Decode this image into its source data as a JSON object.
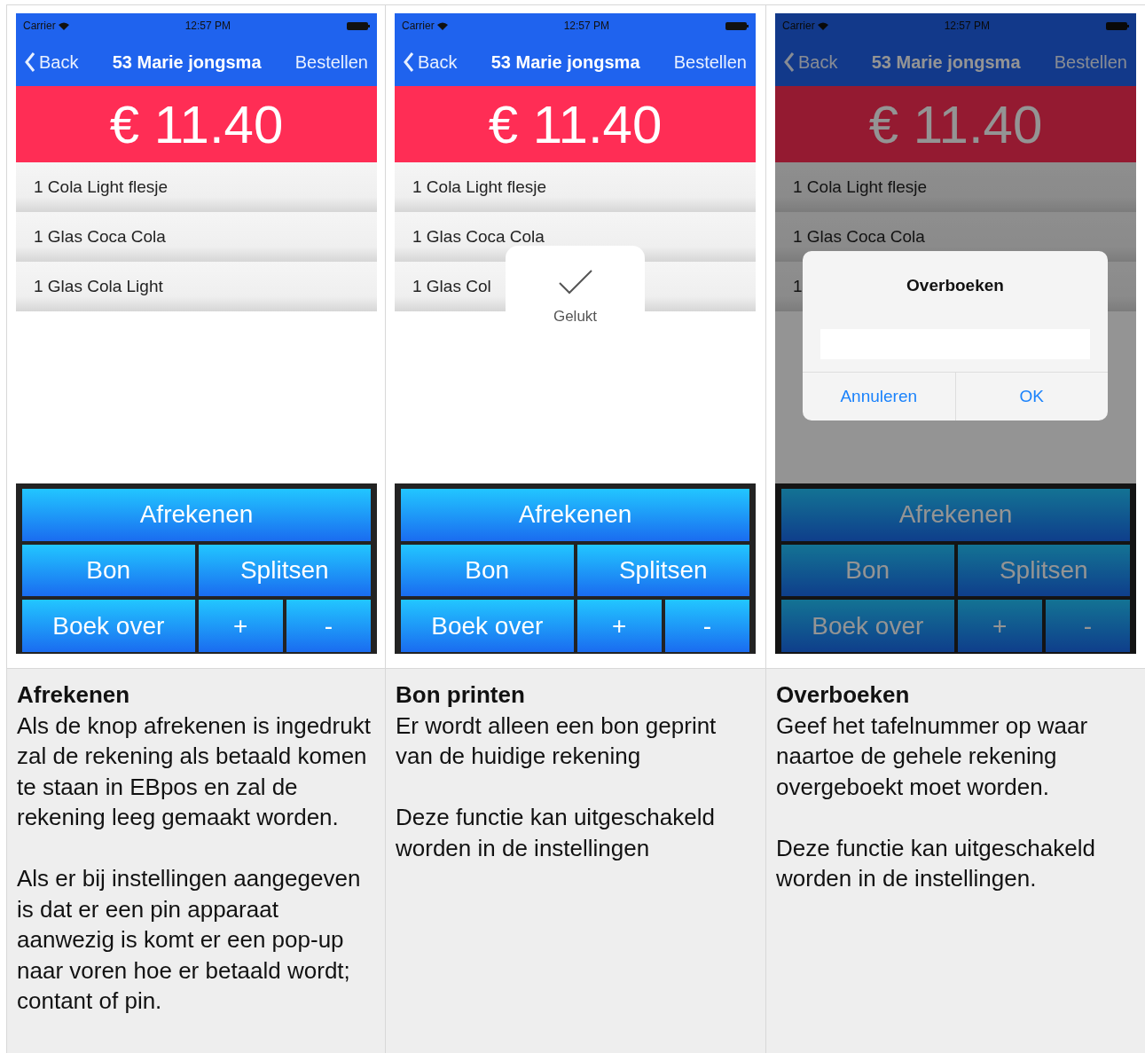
{
  "columns": [
    {
      "screen": {
        "status_bar": {
          "carrier": "Carrier",
          "time": "12:57 PM"
        },
        "nav": {
          "back": "Back",
          "title": "53 Marie jongsma",
          "action": "Bestellen"
        },
        "total": "€ 11.40",
        "items": [
          "1 Cola Light flesje",
          "1 Glas Coca Cola",
          "1 Glas Cola Light"
        ],
        "button_rows": [
          [
            "Afrekenen"
          ],
          [
            "Bon",
            "Splitsen"
          ],
          [
            "Boek over",
            "+",
            "-"
          ]
        ],
        "dimmed": false
      },
      "caption": {
        "title": "Afrekenen",
        "paragraphs": [
          "Als de knop afrekenen is ingedrukt zal de rekening als betaald komen te staan in EBpos en zal de rekening leeg gemaakt worden.",
          "Als er bij instellingen aangegeven is dat er een pin apparaat aanwezig is komt er een pop-up naar voren hoe er betaald wordt; contant of pin."
        ]
      }
    },
    {
      "screen": {
        "status_bar": {
          "carrier": "Carrier",
          "time": "12:57 PM"
        },
        "nav": {
          "back": "Back",
          "title": "53 Marie jongsma",
          "action": "Bestellen"
        },
        "total": "€ 11.40",
        "items": [
          "1 Cola Light flesje",
          "1 Glas Coca Cola",
          "1 Glas Col"
        ],
        "button_rows": [
          [
            "Afrekenen"
          ],
          [
            "Bon",
            "Splitsen"
          ],
          [
            "Boek over",
            "+",
            "-"
          ]
        ],
        "dimmed": false,
        "overlay": {
          "kind": "hud",
          "label": "Gelukt"
        }
      },
      "caption": {
        "title": "Bon printen",
        "paragraphs": [
          "Er wordt alleen een bon geprint van de huidige rekening",
          "Deze functie kan uitgeschakeld worden in de instellingen"
        ]
      }
    },
    {
      "screen": {
        "status_bar": {
          "carrier": "Carrier",
          "time": "12:57 PM"
        },
        "nav": {
          "back": "Back",
          "title": "53 Marie jongsma",
          "action": "Bestellen"
        },
        "total": "€ 11.40",
        "items": [
          "1 Cola Light flesje",
          "1 Glas Coca Cola",
          "1"
        ],
        "button_rows": [
          [
            "Afrekenen"
          ],
          [
            "Bon",
            "Splitsen"
          ],
          [
            "Boek over",
            "+",
            "-"
          ]
        ],
        "dimmed": true,
        "overlay": {
          "kind": "alert",
          "title": "Overboeken",
          "buttons": [
            "Annuleren",
            "OK"
          ]
        }
      },
      "caption": {
        "title": "Overboeken",
        "paragraphs": [
          "Geef het tafelnummer op waar naartoe de gehele rekening overgeboekt moet worden.",
          "Deze functie kan uitgeschakeld worden in de instellingen."
        ]
      }
    }
  ]
}
